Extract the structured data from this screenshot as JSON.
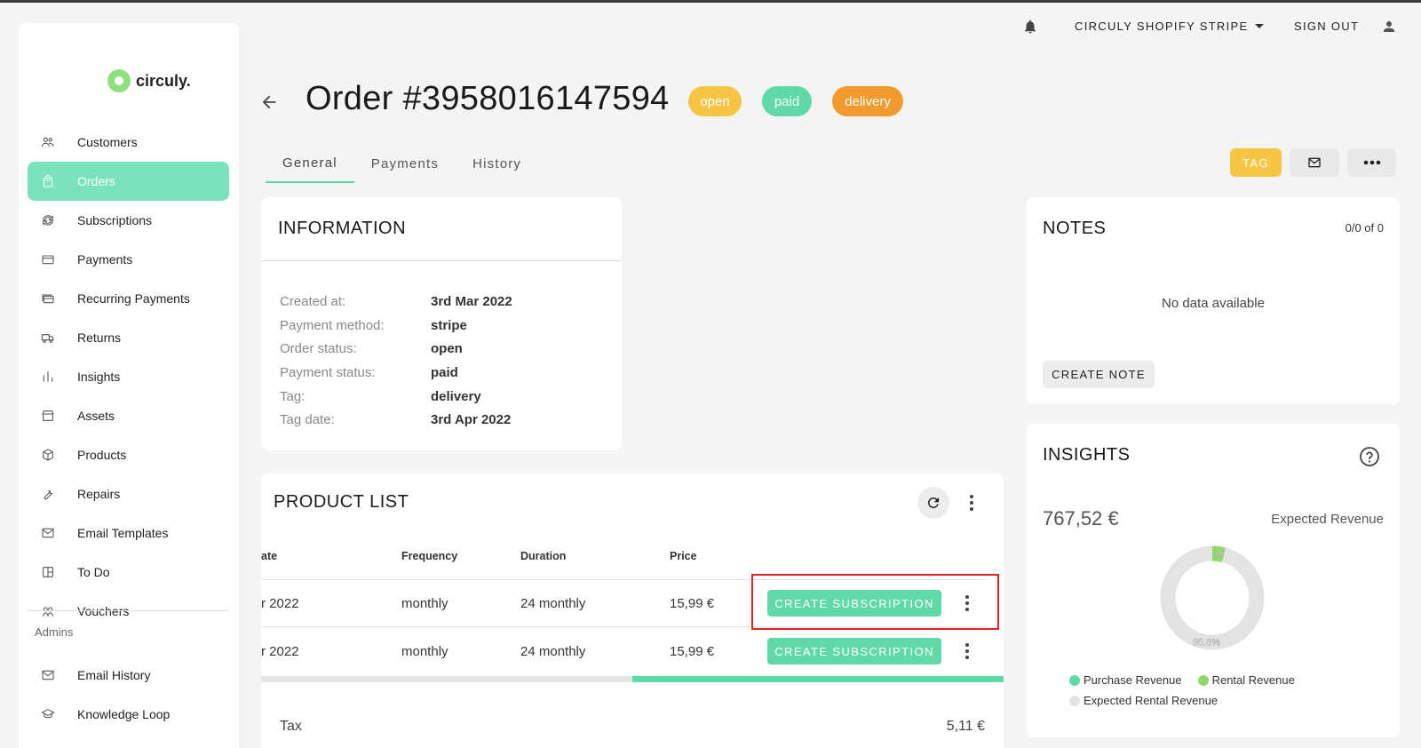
{
  "app": {
    "logo_text": "circuly."
  },
  "topbar": {
    "store_name": "CIRCULY SHOPIFY STRIPE",
    "sign_out": "SIGN OUT"
  },
  "sidebar": {
    "items": [
      {
        "label": "Customers",
        "icon": "customers-icon"
      },
      {
        "label": "Orders",
        "icon": "bag-icon",
        "active": true
      },
      {
        "label": "Subscriptions",
        "icon": "sync-icon"
      },
      {
        "label": "Payments",
        "icon": "card-icon"
      },
      {
        "label": "Recurring Payments",
        "icon": "recurring-card-icon"
      },
      {
        "label": "Returns",
        "icon": "truck-icon"
      },
      {
        "label": "Insights",
        "icon": "bar-chart-icon"
      },
      {
        "label": "Assets",
        "icon": "store-icon"
      },
      {
        "label": "Products",
        "icon": "box-icon"
      },
      {
        "label": "Repairs",
        "icon": "wrench-icon"
      },
      {
        "label": "Email Templates",
        "icon": "mail-icon"
      },
      {
        "label": "To Do",
        "icon": "board-icon"
      },
      {
        "label": "Vouchers",
        "icon": "vouchers-icon"
      }
    ],
    "admins_label": "Admins",
    "admin_items": [
      {
        "label": "Email History",
        "icon": "mail-icon"
      },
      {
        "label": "Knowledge Loop",
        "icon": "graduation-icon"
      }
    ]
  },
  "order": {
    "title": "Order #3958016147594",
    "badges": [
      {
        "label": "open",
        "color": "#f6c544"
      },
      {
        "label": "paid",
        "color": "#5fd9a8"
      },
      {
        "label": "delivery",
        "color": "#f29a2e"
      }
    ]
  },
  "tabs": [
    "General",
    "Payments",
    "History"
  ],
  "actions": {
    "tag_label": "TAG"
  },
  "information": {
    "title": "INFORMATION",
    "rows": [
      {
        "label": "Created at:",
        "value": "3rd Mar 2022"
      },
      {
        "label": "Payment method:",
        "value": "stripe"
      },
      {
        "label": "Order status:",
        "value": "open"
      },
      {
        "label": "Payment status:",
        "value": "paid"
      },
      {
        "label": "Tag:",
        "value": "delivery"
      },
      {
        "label": "Tag date:",
        "value": "3rd Apr 2022"
      }
    ]
  },
  "product_list": {
    "title": "PRODUCT LIST",
    "columns": [
      "ate",
      "Frequency",
      "Duration",
      "Price"
    ],
    "rows": [
      {
        "date": "r 2022",
        "frequency": "monthly",
        "duration": "24 monthly",
        "price": "15,99 €",
        "action": "CREATE SUBSCRIPTION"
      },
      {
        "date": "r 2022",
        "frequency": "monthly",
        "duration": "24 monthly",
        "price": "15,99 €",
        "action": "CREATE SUBSCRIPTION"
      }
    ],
    "scroll_position": 0.5,
    "tax_label": "Tax",
    "tax_value": "5,11 €"
  },
  "notes": {
    "title": "NOTES",
    "pagination": "0/0 of 0",
    "empty": "No data available",
    "create_label": "CREATE NOTE"
  },
  "insights": {
    "title": "INSIGHTS",
    "amount": "767,52 €",
    "amount_label": "Expected Revenue",
    "chart_data": {
      "type": "pie",
      "slices": [
        {
          "label": "Rental Revenue",
          "value": 4.2,
          "display": "4.2%",
          "color": "#8fd96a"
        },
        {
          "label": "Expected Rental Revenue",
          "value": 95.8,
          "display": "95.8%",
          "color": "#e3e3e3"
        }
      ],
      "legend": [
        {
          "label": "Purchase Revenue",
          "color": "#5fd9a8"
        },
        {
          "label": "Rental Revenue",
          "color": "#8fd96a"
        },
        {
          "label": "Expected Rental Revenue",
          "color": "#e3e3e3"
        }
      ]
    }
  }
}
